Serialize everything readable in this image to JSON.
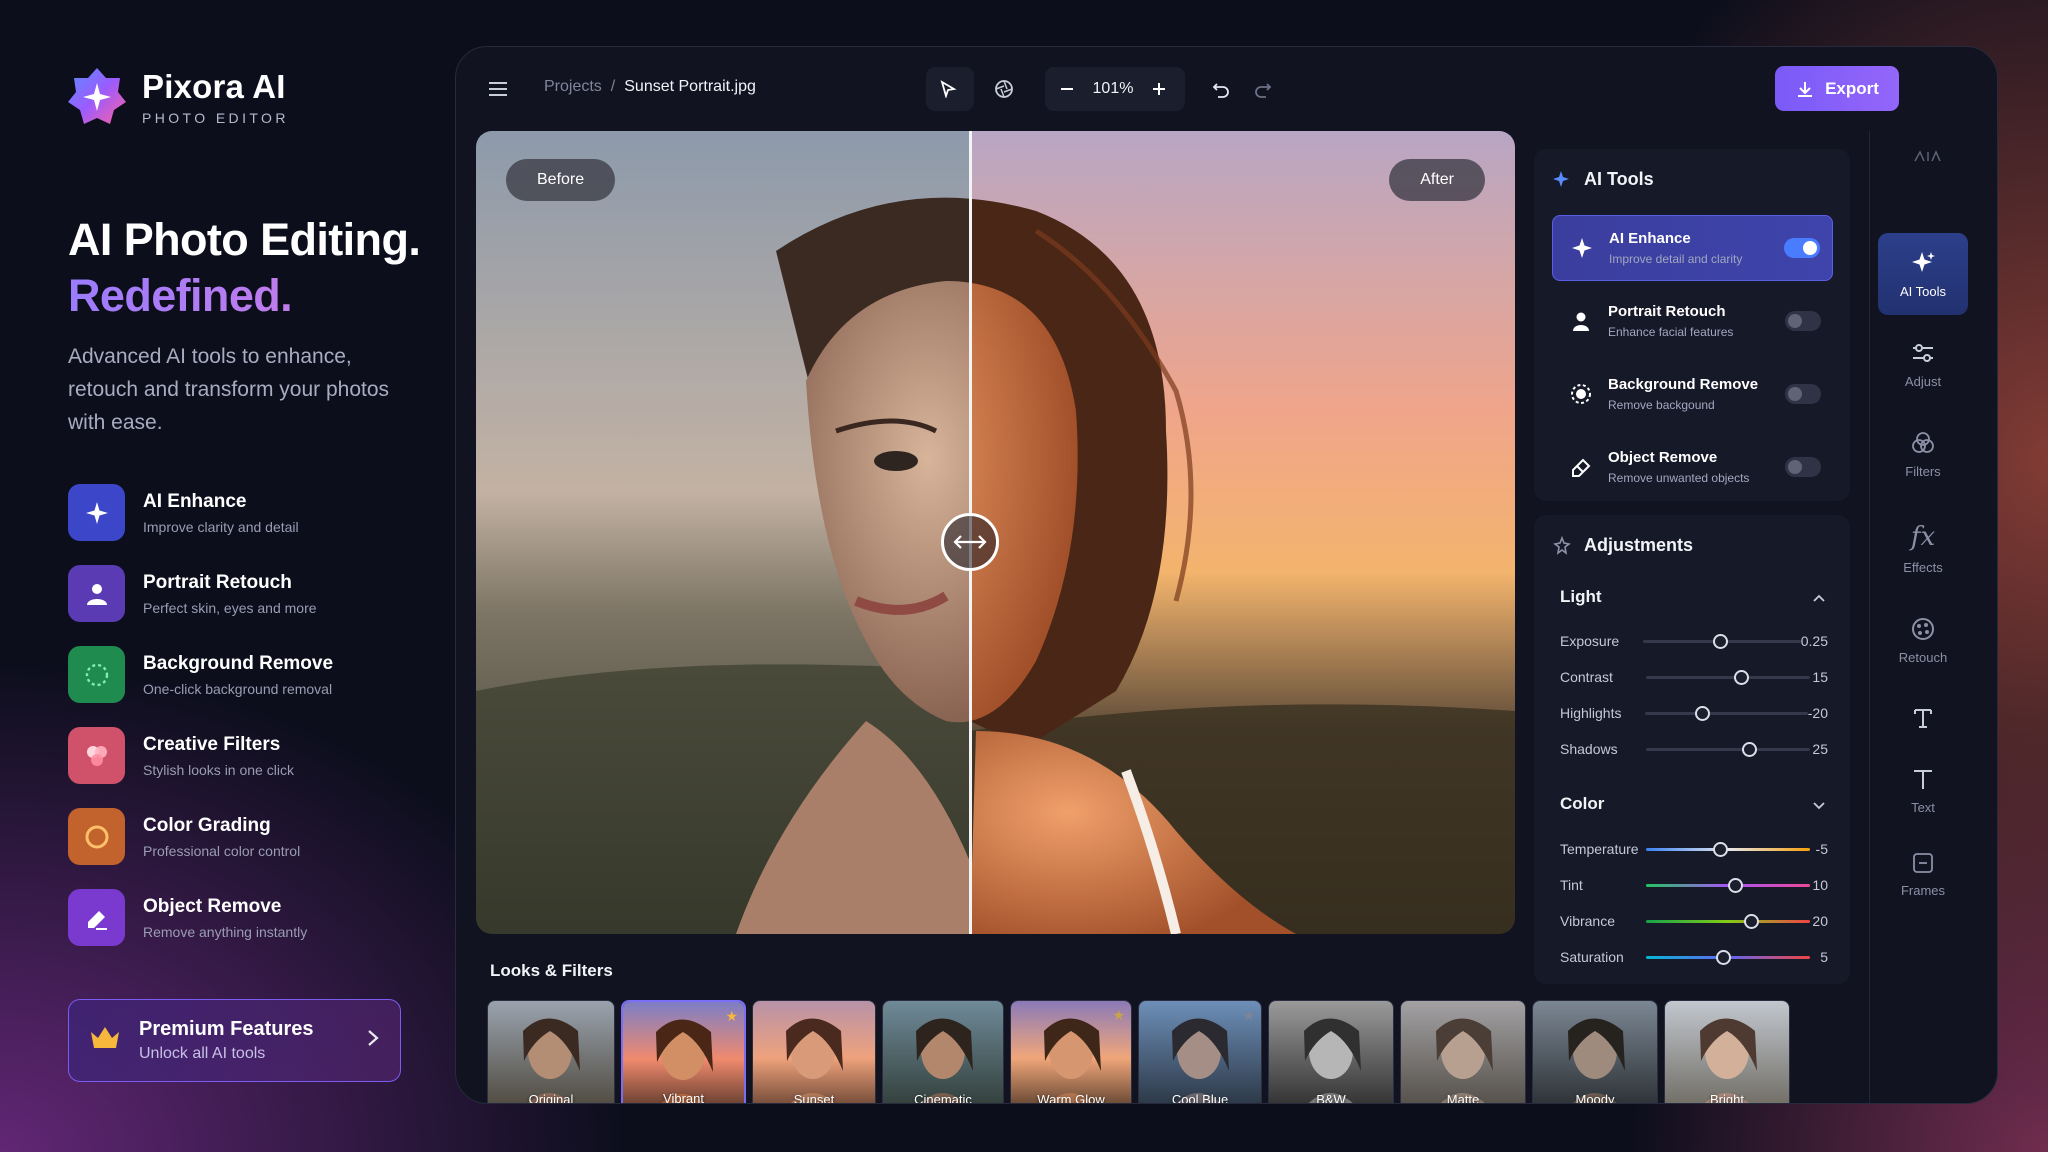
{
  "brand": {
    "name": "Pixora AI",
    "subtitle": "PHOTO EDITOR"
  },
  "hero": {
    "title_line1": "AI Photo Editing.",
    "title_line2": "Redefined.",
    "description": "Advanced AI tools to enhance, retouch and transform your photos with ease."
  },
  "features": [
    {
      "title": "AI Enhance",
      "subtitle": "Improve clarity and detail",
      "icon": "sparkle-icon",
      "color": "#3b46c9"
    },
    {
      "title": "Portrait Retouch",
      "subtitle": "Perfect skin, eyes and more",
      "icon": "person-icon",
      "color": "#5a3bb4"
    },
    {
      "title": "Background Remove",
      "subtitle": "One-click background removal",
      "icon": "background-remove-icon",
      "color": "#1f8b4f"
    },
    {
      "title": "Creative Filters",
      "subtitle": "Stylish looks in one click",
      "icon": "filters-icon",
      "color": "#d0526a"
    },
    {
      "title": "Color Grading",
      "subtitle": "Professional color control",
      "icon": "color-ring-icon",
      "color": "#c2622d"
    },
    {
      "title": "Object Remove",
      "subtitle": "Remove anything instantly",
      "icon": "eraser-icon",
      "color": "#7a3ad0"
    }
  ],
  "premium": {
    "title": "Premium Features",
    "subtitle": "Unlock all AI tools"
  },
  "topbar": {
    "breadcrumb_root": "Projects",
    "breadcrumb_sep": "/",
    "breadcrumb_current": "Sunset Portrait.jpg",
    "zoom": "101%",
    "export_label": "Export"
  },
  "canvas": {
    "before_label": "Before",
    "after_label": "After"
  },
  "looks": {
    "title": "Looks & Filters",
    "items": [
      {
        "label": "Original",
        "selected": false
      },
      {
        "label": "Vibrant",
        "selected": true,
        "starred": true
      },
      {
        "label": "Sunset",
        "selected": false
      },
      {
        "label": "Cinematic",
        "selected": false
      },
      {
        "label": "Warm Glow",
        "selected": false,
        "starred": true
      },
      {
        "label": "Cool Blue",
        "selected": false,
        "starred": true
      },
      {
        "label": "B&W",
        "selected": false
      },
      {
        "label": "Matte",
        "selected": false
      },
      {
        "label": "Moody",
        "selected": false
      },
      {
        "label": "Bright",
        "selected": false
      }
    ]
  },
  "ai_tools": {
    "title": "AI Tools",
    "items": [
      {
        "title": "AI Enhance",
        "subtitle": "Improve detail and clarity",
        "enabled": true
      },
      {
        "title": "Portrait Retouch",
        "subtitle": "Enhance facial features",
        "enabled": false
      },
      {
        "title": "Background Remove",
        "subtitle": "Remove backgound",
        "enabled": false
      },
      {
        "title": "Object Remove",
        "subtitle": "Remove unwanted objects",
        "enabled": false
      }
    ]
  },
  "adjustments": {
    "title": "Adjustments",
    "light": {
      "title": "Light",
      "sliders": [
        {
          "label": "Exposure",
          "value": "0.25",
          "level": 0.49
        },
        {
          "label": "Contrast",
          "value": "15",
          "level": 0.58
        },
        {
          "label": "Highlights",
          "value": "-20",
          "level": 0.35
        },
        {
          "label": "Shadows",
          "value": "25",
          "level": 0.63
        }
      ]
    },
    "color": {
      "title": "Color",
      "sliders": [
        {
          "label": "Temperature",
          "value": "-5",
          "level": 0.45
        },
        {
          "label": "Tint",
          "value": "10",
          "level": 0.54
        },
        {
          "label": "Vibrance",
          "value": "20",
          "level": 0.64
        },
        {
          "label": "Saturation",
          "value": "5",
          "level": 0.47
        }
      ]
    }
  },
  "rail": [
    {
      "label": "AI Tools",
      "icon": "sparkle-icon",
      "active": true
    },
    {
      "label": "Adjust",
      "icon": "sliders-icon",
      "active": false
    },
    {
      "label": "Filters",
      "icon": "filters-icon",
      "active": false
    },
    {
      "label": "Effects",
      "icon": "fx-icon",
      "active": false
    },
    {
      "label": "Retouch",
      "icon": "retouch-icon",
      "active": false
    },
    {
      "label": "",
      "icon": "text-tool-icon",
      "active": false
    },
    {
      "label": "Text",
      "icon": "text-icon",
      "active": false
    },
    {
      "label": "Frames",
      "icon": "frames-icon",
      "active": false
    }
  ]
}
